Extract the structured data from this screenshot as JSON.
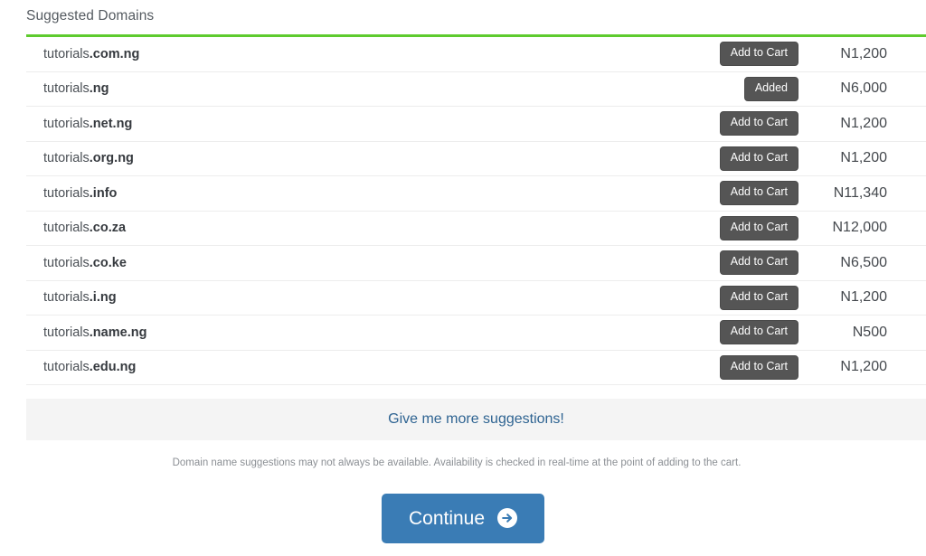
{
  "panel": {
    "heading": "Suggested Domains",
    "accent_color": "#5ecb2e"
  },
  "domains": [
    {
      "prefix": "tutorials",
      "tld": ".com.ng",
      "button_label": "Add to Cart",
      "added": false,
      "price": "N1,200"
    },
    {
      "prefix": "tutorials",
      "tld": ".ng",
      "button_label": "Added",
      "added": true,
      "price": "N6,000"
    },
    {
      "prefix": "tutorials",
      "tld": ".net.ng",
      "button_label": "Add to Cart",
      "added": false,
      "price": "N1,200"
    },
    {
      "prefix": "tutorials",
      "tld": ".org.ng",
      "button_label": "Add to Cart",
      "added": false,
      "price": "N1,200"
    },
    {
      "prefix": "tutorials",
      "tld": ".info",
      "button_label": "Add to Cart",
      "added": false,
      "price": "N11,340"
    },
    {
      "prefix": "tutorials",
      "tld": ".co.za",
      "button_label": "Add to Cart",
      "added": false,
      "price": "N12,000"
    },
    {
      "prefix": "tutorials",
      "tld": ".co.ke",
      "button_label": "Add to Cart",
      "added": false,
      "price": "N6,500"
    },
    {
      "prefix": "tutorials",
      "tld": ".i.ng",
      "button_label": "Add to Cart",
      "added": false,
      "price": "N1,200"
    },
    {
      "prefix": "tutorials",
      "tld": ".name.ng",
      "button_label": "Add to Cart",
      "added": false,
      "price": "N500"
    },
    {
      "prefix": "tutorials",
      "tld": ".edu.ng",
      "button_label": "Add to Cart",
      "added": false,
      "price": "N1,200"
    }
  ],
  "more_suggestions": {
    "label": "Give me more suggestions!",
    "link_color": "#2f6492"
  },
  "disclaimer": "Domain name suggestions may not always be available. Availability is checked in real-time at the point of adding to the cart.",
  "continue": {
    "label": "Continue",
    "icon": "arrow-right-circle-icon",
    "color": "#3a7cb5"
  }
}
